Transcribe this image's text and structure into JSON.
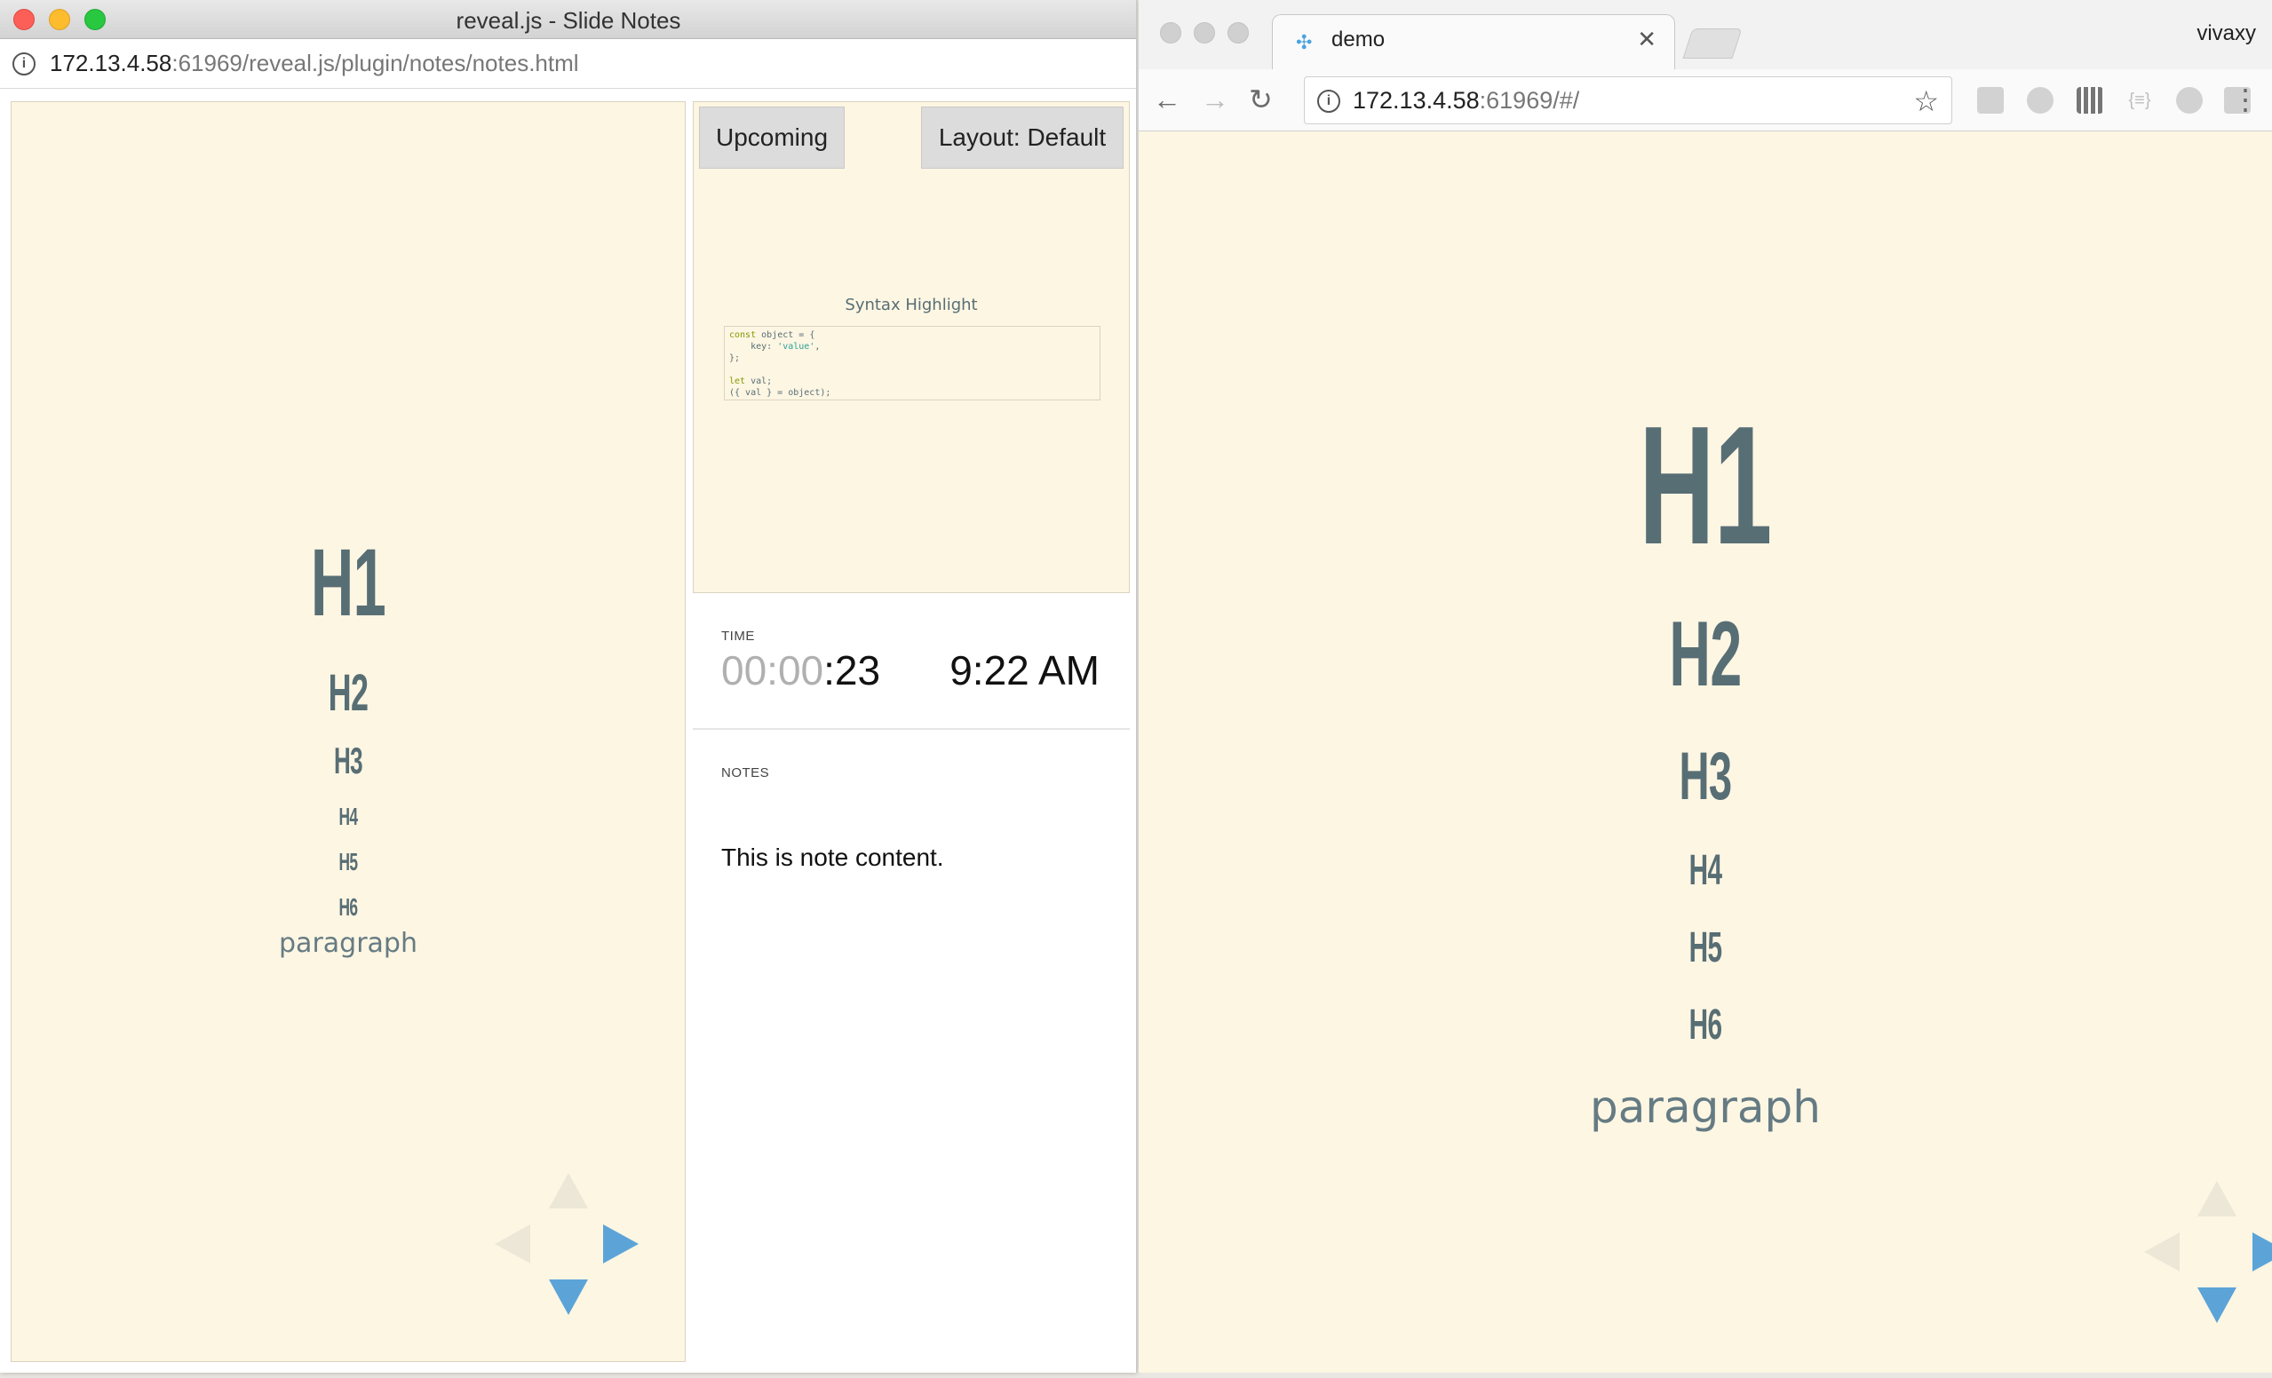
{
  "notes_window": {
    "title": "reveal.js - Slide Notes",
    "url_host": "172.13.4.58",
    "url_rest": ":61969/reveal.js/plugin/notes/notes.html",
    "current_slide": {
      "h1": "H1",
      "h2": "H2",
      "h3": "H3",
      "h4": "H4",
      "h5": "H5",
      "h6": "H6",
      "paragraph": "paragraph"
    },
    "upcoming": {
      "button_label": "Upcoming",
      "layout_label": "Layout: Default",
      "slide_title": "Syntax Highlight",
      "code_lines": [
        "const object = {",
        "    key: 'value',",
        "};",
        "",
        "let val;",
        "({ val } = object);"
      ]
    },
    "time": {
      "label": "TIME",
      "timer_hours": "00",
      "timer_minutes": "00",
      "timer_seconds": "23",
      "clock": "9:22 AM"
    },
    "notes": {
      "label": "NOTES",
      "content": "This is note content."
    }
  },
  "browser_window": {
    "tab_title": "demo",
    "profile_name": "vivaxy",
    "url_host": "172.13.4.58",
    "url_rest": ":61969/#/",
    "slide": {
      "h1": "H1",
      "h2": "H2",
      "h3": "H3",
      "h4": "H4",
      "h5": "H5",
      "h6": "H6",
      "paragraph": "paragraph"
    }
  },
  "colors": {
    "slide_background": "#fdf6e3",
    "heading_color": "#586e75",
    "nav_arrow_active": "#5ca4d8",
    "nav_arrow_disabled": "#ece7d6"
  },
  "icons": [
    "close-dot",
    "minimize-dot",
    "maximize-dot",
    "info-icon",
    "back-arrow-icon",
    "forward-arrow-icon",
    "reload-icon",
    "star-icon",
    "menu-dots-icon",
    "nav-up-icon",
    "nav-down-icon",
    "nav-left-icon",
    "nav-right-icon"
  ]
}
